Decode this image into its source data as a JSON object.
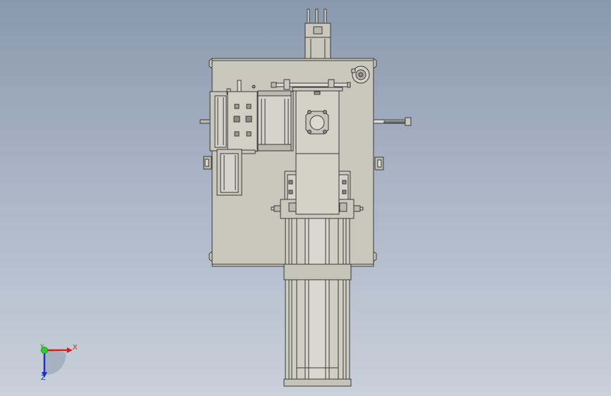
{
  "viewport": {
    "background_top": "#8a98ae",
    "background_bottom": "#c9d0da",
    "part_fill": "#c8c8bd",
    "edge_color": "#3a3a3a"
  },
  "triad": {
    "x_label": "X",
    "y_label": "Y",
    "z_label": "Z",
    "x_color": "#d62020",
    "y_color": "#1a9a1a",
    "z_color": "#2030c0"
  }
}
